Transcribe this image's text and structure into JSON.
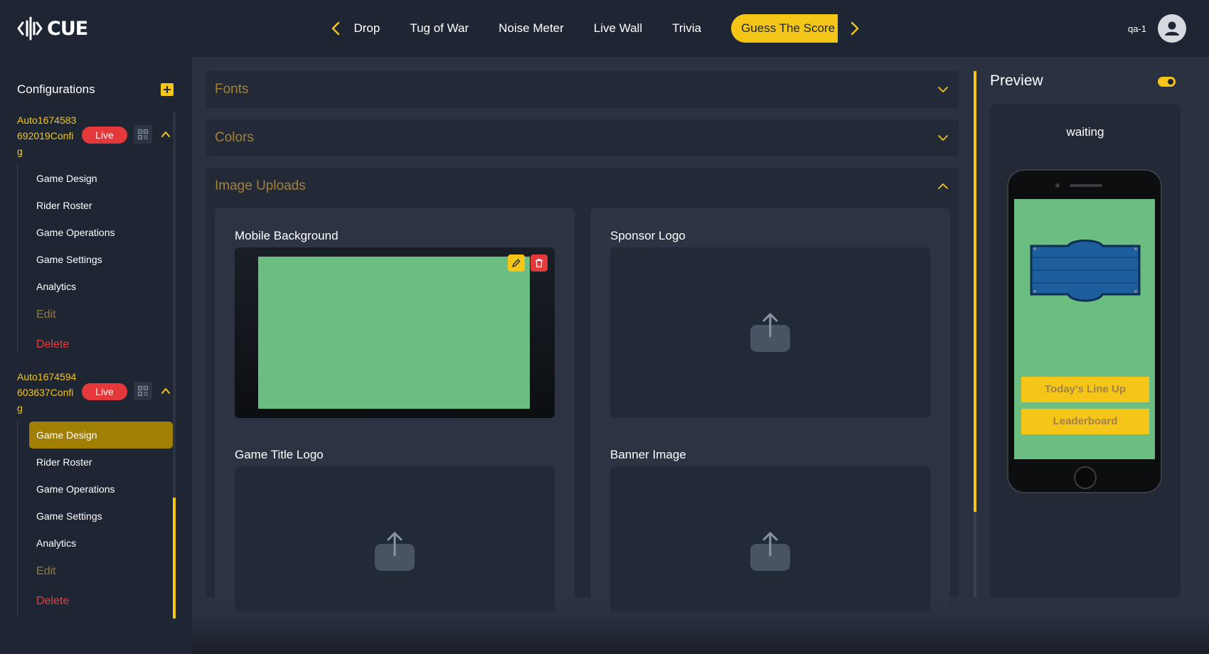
{
  "app": {
    "logo_text": "CUE"
  },
  "header": {
    "tabs": [
      {
        "label": "Prize Drop"
      },
      {
        "label": "Tug of War"
      },
      {
        "label": "Noise Meter"
      },
      {
        "label": "Live Wall"
      },
      {
        "label": "Trivia"
      },
      {
        "label": "Guess The Score"
      }
    ],
    "active_tab": "Guess The Score",
    "username": "qa-1"
  },
  "sidebar": {
    "title": "Configurations",
    "configs": [
      {
        "name": "Auto1674583692019Config",
        "status": "Live",
        "expanded": true,
        "items": [
          "Game Design",
          "Rider Roster",
          "Game Operations",
          "Game Settings",
          "Analytics"
        ],
        "edit_label": "Edit",
        "delete_label": "Delete"
      },
      {
        "name": "Auto1674594603637Config",
        "status": "Live",
        "expanded": true,
        "active_item": "Game Design",
        "items": [
          "Game Design",
          "Rider Roster",
          "Game Operations",
          "Game Settings",
          "Analytics"
        ],
        "edit_label": "Edit",
        "delete_label": "Delete"
      }
    ]
  },
  "main": {
    "sections": [
      {
        "title": "Fonts",
        "expanded": false
      },
      {
        "title": "Colors",
        "expanded": false
      },
      {
        "title": "Image Uploads",
        "expanded": true
      }
    ],
    "uploads": [
      {
        "label": "Mobile Background",
        "has_image": true,
        "image_color": "#6bbd81"
      },
      {
        "label": "Sponsor Logo",
        "has_image": false
      },
      {
        "label": "Game Title Logo",
        "has_image": false
      },
      {
        "label": "Banner Image",
        "has_image": false
      }
    ]
  },
  "preview": {
    "title": "Preview",
    "toggle_on": true,
    "state_text": "waiting",
    "buttons": [
      "Today's Line Up",
      "Leaderboard"
    ]
  },
  "colors": {
    "accent": "#f5c518",
    "live": "#e5383b",
    "delete": "#ef3b3b",
    "background": "#1f2633",
    "panel": "#232a37",
    "preview_screen": "#6bbd81"
  },
  "icons": [
    "cue-logo-icon",
    "chevron-left-icon",
    "chevron-right-icon",
    "user-avatar-icon",
    "plus-icon",
    "qr-code-icon",
    "chevron-up-icon",
    "chevron-down-icon",
    "pencil-icon",
    "trash-icon",
    "upload-icon"
  ]
}
